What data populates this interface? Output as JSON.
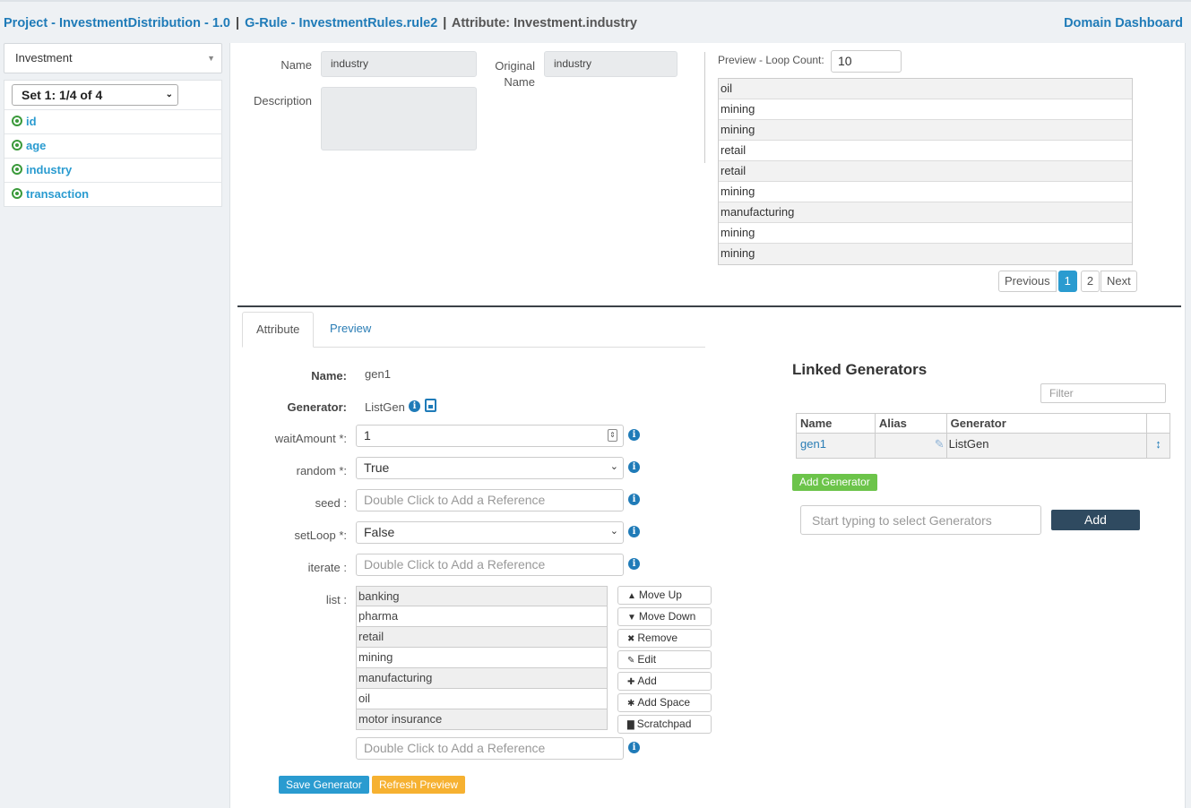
{
  "breadcrumb": {
    "project": "Project - InvestmentDistribution - 1.0",
    "sep1": "|",
    "rule": "G-Rule - InvestmentRules.rule2",
    "sep2": "|",
    "attribute": "Attribute: Investment.industry"
  },
  "domain_dashboard": "Domain Dashboard",
  "sidebar": {
    "domain": "Investment",
    "set_select": "Set 1: 1/4 of 4",
    "attributes": [
      "id",
      "age",
      "industry",
      "transaction"
    ]
  },
  "attr_info": {
    "name_label": "Name",
    "name_value": "industry",
    "original_label": "Original Name",
    "original_value": "industry",
    "description_label": "Description"
  },
  "preview": {
    "loop_label": "Preview - Loop Count:",
    "loop_count": "10",
    "rows": [
      "oil",
      "mining",
      "mining",
      "retail",
      "retail",
      "mining",
      "manufacturing",
      "mining",
      "mining"
    ],
    "pager": {
      "previous": "Previous",
      "page1": "1",
      "page2": "2",
      "next": "Next"
    }
  },
  "tabs": {
    "attribute": "Attribute",
    "preview": "Preview"
  },
  "form": {
    "name_label": "Name:",
    "name_value": "gen1",
    "generator_label": "Generator:",
    "generator_value": "ListGen",
    "wait_label": "waitAmount *:",
    "wait_value": "1",
    "random_label": "random *:",
    "random_value": "True",
    "seed_label": "seed :",
    "ref_placeholder": "Double Click to Add a Reference",
    "setloop_label": "setLoop *:",
    "setloop_value": "False",
    "iterate_label": "iterate :",
    "list_label": "list :",
    "list_items": [
      "banking",
      "pharma",
      "retail",
      "mining",
      "manufacturing",
      "oil",
      "motor insurance"
    ],
    "list_buttons": {
      "move_up": "Move Up",
      "move_down": "Move Down",
      "remove": "Remove",
      "edit": "Edit",
      "add": "Add",
      "add_space": "Add Space",
      "scratchpad": "Scratchpad"
    },
    "save": "Save Generator",
    "refresh": "Refresh Preview"
  },
  "linked": {
    "title": "Linked Generators",
    "filter_placeholder": "Filter",
    "headers": {
      "name": "Name",
      "alias": "Alias",
      "generator": "Generator"
    },
    "rows": [
      {
        "name": "gen1",
        "alias": "",
        "generator": "ListGen"
      }
    ],
    "add_generator": "Add Generator",
    "select_placeholder": "Start typing to select Generators",
    "add": "Add"
  },
  "colors": {
    "link": "#1f7bb8",
    "accent": "#2a9bd0",
    "save": "#2a9bd0",
    "refresh": "#f6b131",
    "add_generator": "#6cc44a",
    "add_button": "#2f4a60"
  }
}
